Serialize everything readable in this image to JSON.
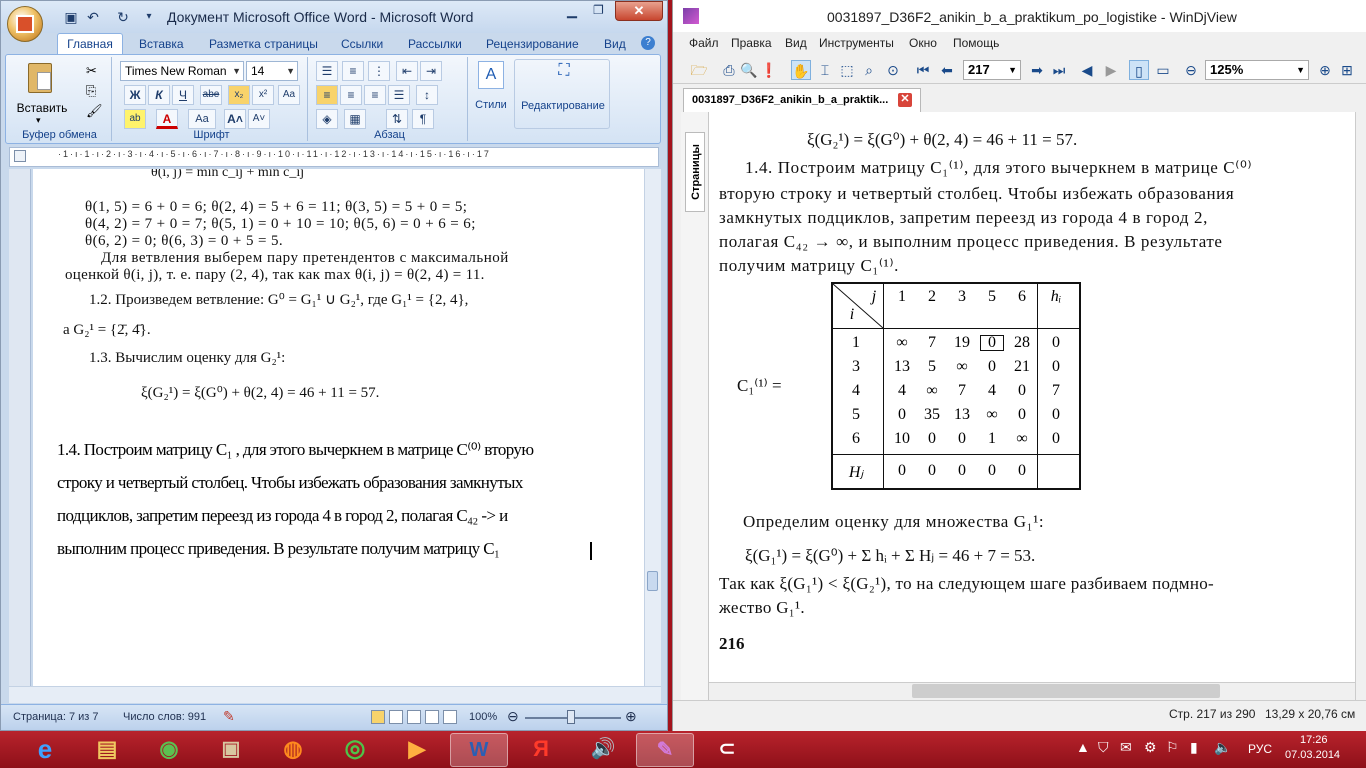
{
  "word": {
    "title": "Документ Microsoft Office Word - Microsoft Word",
    "tabs": [
      "Главная",
      "Вставка",
      "Разметка страницы",
      "Ссылки",
      "Рассылки",
      "Рецензирование",
      "Вид"
    ],
    "font_name": "Times New Roman",
    "font_size": "14",
    "paste_label": "Вставить",
    "styles_label": "Стили",
    "editing_label": "Редактирование",
    "group_clipboard": "Буфер обмена",
    "group_font": "Шрифт",
    "group_paragraph": "Абзац",
    "doc_scan": {
      "line0": "θ(i, j) = min c_ij + min c_ij",
      "line1": "θ(1, 5) = 6 + 0 = 6; θ(2, 4) = 5 + 6 = 11; θ(3, 5) = 5 + 0 = 5;",
      "line2": "θ(4, 2) = 7 + 0 = 7; θ(5, 1) = 0 + 10 = 10; θ(5, 6) = 0 + 6 = 6;",
      "line3": "θ(6, 2) = 0; θ(6, 3) = 0 + 5 = 5.",
      "line4": "Для ветвления выберем пару претендентов с максимальной",
      "line5": "оценкой θ(i, j), т. е. пару (2, 4), так как max θ(i, j) = θ(2, 4) = 11.",
      "line6": "1.2. Произведем ветвление: G⁰ = G₁¹ ∪ G₂¹, где G₁¹ = {2, 4},",
      "line7": "а G₂¹ = {2̄, 4̄}.",
      "line8": "1.3. Вычислим оценку для G₂¹:",
      "line9": "ξ(G₂¹) = ξ(G⁰) + θ(2, 4) = 46 + 11 = 57."
    },
    "typed": [
      "1.4. Построим матрицу C₁ , для этого вычеркнем в матрице C⁽⁰⁾ вторую",
      "строку и четвертый столбец. Чтобы избежать образования замкнутых",
      "подциклов, запретим переезд из города 4 в город 2, полагая C₄₂ -> и",
      "выполним процесс приведения. В результате получим матрицу C₁"
    ],
    "status_page": "Страница: 7 из 7",
    "status_words": "Число слов: 991",
    "zoom": "100%"
  },
  "djview": {
    "title": "0031897_D36F2_anikin_b_a_praktikum_po_logistike - WinDjView",
    "menu": [
      "Файл",
      "Правка",
      "Вид",
      "Инструменты",
      "Окно",
      "Помощь"
    ],
    "page_field": "217",
    "zoom_field": "125%",
    "tab_label": "0031897_D36F2_anikin_b_a_praktik...",
    "side_label": "Страницы",
    "page": {
      "eq1": "ξ(G₂¹) = ξ(G⁰) + θ(2, 4) = 46 + 11 = 57.",
      "p1": "1.4. Построим матрицу C₁⁽¹⁾, для этого вычеркнем в матрице C⁽⁰⁾",
      "p2": "вторую строку и четвертый столбец. Чтобы избежать образования",
      "p3": "замкнутых подциклов, запретим переезд из города 4 в город 2,",
      "p4": "полагая C₄₂ → ∞, и выполним процесс приведения. В результате",
      "p5": "получим матрицу C₁⁽¹⁾.",
      "matrix_label": "C₁⁽¹⁾ =",
      "col_headers": [
        "j",
        "1",
        "2",
        "3",
        "5",
        "6",
        "hᵢ"
      ],
      "row_header": "i",
      "rows": [
        {
          "i": "1",
          "vals": [
            "∞",
            "7",
            "19",
            "0",
            "28"
          ],
          "h": "0"
        },
        {
          "i": "3",
          "vals": [
            "13",
            "5",
            "∞",
            "0",
            "21"
          ],
          "h": "0"
        },
        {
          "i": "4",
          "vals": [
            "4",
            "∞",
            "7",
            "4",
            "0"
          ],
          "h": "7"
        },
        {
          "i": "5",
          "vals": [
            "0",
            "35",
            "13",
            "∞",
            "0"
          ],
          "h": "0"
        },
        {
          "i": "6",
          "vals": [
            "10",
            "0",
            "0",
            "1",
            "∞"
          ],
          "h": "0"
        }
      ],
      "H_label": "Hⱼ",
      "H_vals": [
        "0",
        "0",
        "0",
        "0",
        "0"
      ],
      "p6": "Определим оценку для множества G₁¹:",
      "eq2": "ξ(G₁¹) = ξ(G⁰) + Σ hᵢ + Σ Hⱼ = 46 + 7 = 53.",
      "p7": "Так как ξ(G₁¹) < ξ(G₂¹), то на следующем шаге разбиваем подмно-",
      "p8": "жество G₁¹.",
      "page_num": "216"
    },
    "status_page": "Стр. 217 из 290",
    "status_size": "13,29 x 20,76 см"
  },
  "taskbar": {
    "lang": "РУС",
    "time": "17:26",
    "date": "07.03.2014"
  }
}
